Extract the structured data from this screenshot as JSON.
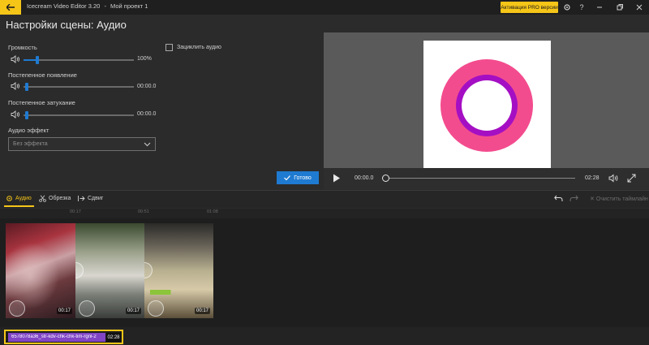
{
  "titlebar": {
    "app_name": "Icecream Video Editor 3.20",
    "separator": "-",
    "project": "Мой проект 1",
    "pro_button": "Активация PRO версии"
  },
  "scene": {
    "title": "Настройки сцены: Аудио"
  },
  "settings": {
    "volume": {
      "label": "Громкость",
      "value_text": "100%",
      "level": 0.11
    },
    "fade_in": {
      "label": "Постепенное появление",
      "value_text": "00:00.0",
      "level": 0.0
    },
    "fade_out": {
      "label": "Постепенное затухание",
      "value_text": "00:00.0",
      "level": 0.0
    },
    "loop_audio": {
      "label": "Зациклить аудио",
      "checked": false
    },
    "audio_effect": {
      "label": "Аудио эффект",
      "selected": "Без эффекта"
    },
    "done_button": "Готово"
  },
  "player": {
    "current_time": "00:00.0",
    "total_time": "02:28",
    "progress": 0.0
  },
  "timeline": {
    "tabs": [
      {
        "label": "Аудио",
        "icon": "gear-icon",
        "active": true
      },
      {
        "label": "Обрезка",
        "icon": "scissors-icon",
        "active": false
      },
      {
        "label": "Сдвиг",
        "icon": "arrow-right-icon",
        "active": false
      }
    ],
    "clear_label": "Очистить таймлайн",
    "ruler": [
      "00:17",
      "00:51",
      "01:08"
    ],
    "clips": [
      {
        "duration": "00:17"
      },
      {
        "duration": "00:17"
      },
      {
        "duration": "00:17"
      }
    ],
    "audio_clip": {
      "name": "6578078a36_str-kdv-chk-chk-tim-rgnl-2",
      "duration": "02:28"
    }
  },
  "colors": {
    "accent_yellow": "#f5c518",
    "accent_blue": "#1f7ad1",
    "ring_pink": "#f34c8e",
    "ring_purple": "#a50fc3",
    "audio_purple": "#8044c5"
  }
}
